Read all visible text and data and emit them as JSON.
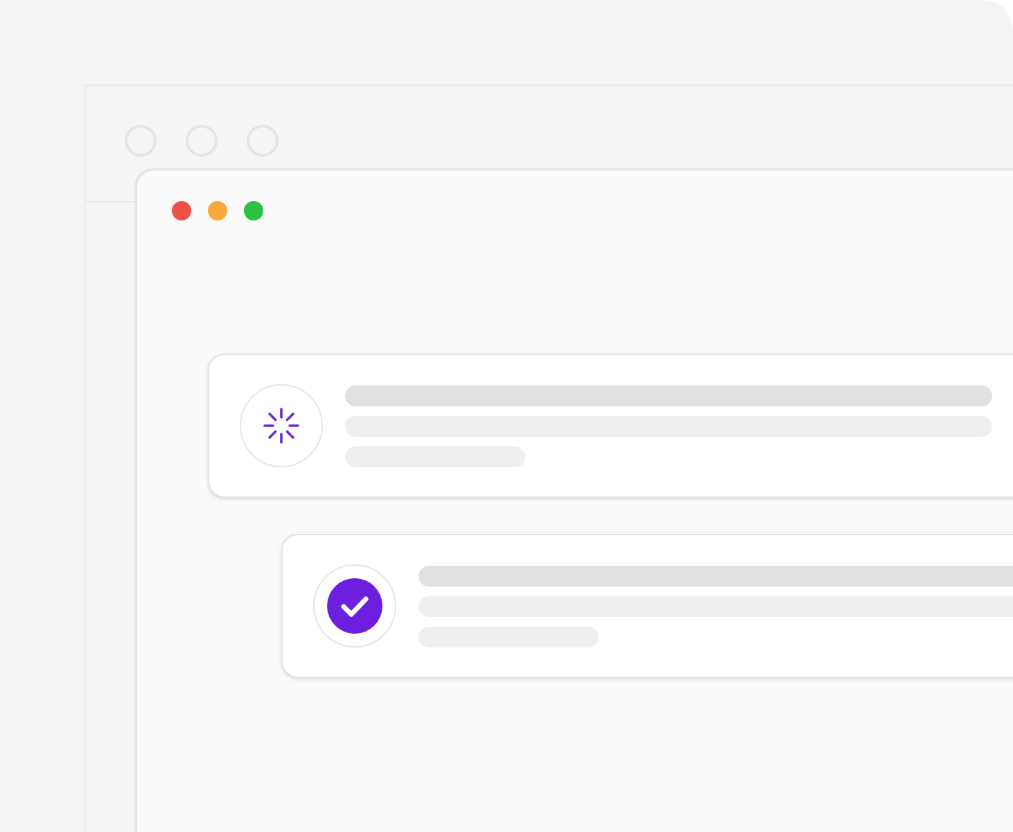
{
  "front_window": {
    "traffic_lights": [
      {
        "color": "#ee5147"
      },
      {
        "color": "#f6a93b"
      },
      {
        "color": "#2bc141"
      }
    ]
  },
  "tasks": [
    {
      "kind": "loading"
    },
    {
      "kind": "done"
    }
  ]
}
